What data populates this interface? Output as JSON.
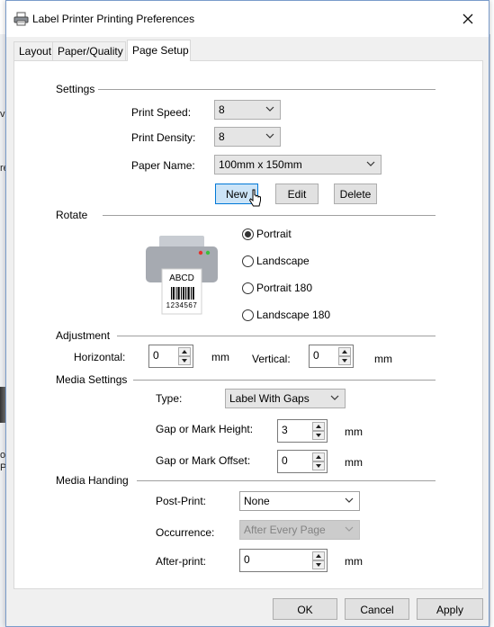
{
  "window": {
    "title": "Label Printer Printing Preferences"
  },
  "background": {
    "frag_top": "vi",
    "frag_mid": "re",
    "frag_bot1": "o",
    "frag_bot2": "P"
  },
  "tabs": [
    {
      "label": "Layout"
    },
    {
      "label": "Paper/Quality"
    },
    {
      "label": "Page Setup"
    }
  ],
  "settings": {
    "section": "Settings",
    "print_speed_label": "Print Speed:",
    "print_speed_value": "8",
    "print_density_label": "Print Density:",
    "print_density_value": "8",
    "paper_name_label": "Paper Name:",
    "paper_name_value": "100mm x 150mm",
    "new_label": "New",
    "edit_label": "Edit",
    "delete_label": "Delete"
  },
  "rotate": {
    "section": "Rotate",
    "preview_text": "ABCD",
    "preview_number": "1234567",
    "options": [
      {
        "label": "Portrait",
        "checked": true
      },
      {
        "label": "Landscape",
        "checked": false
      },
      {
        "label": "Portrait 180",
        "checked": false
      },
      {
        "label": "Landscape 180",
        "checked": false
      }
    ]
  },
  "adjustment": {
    "section": "Adjustment",
    "horizontal_label": "Horizontal:",
    "horizontal_value": "0",
    "horizontal_unit": "mm",
    "vertical_label": "Vertical:",
    "vertical_value": "0",
    "vertical_unit": "mm"
  },
  "media_settings": {
    "section": "Media Settings",
    "type_label": "Type:",
    "type_value": "Label With Gaps",
    "gap_height_label": "Gap or Mark Height:",
    "gap_height_value": "3",
    "gap_height_unit": "mm",
    "gap_offset_label": "Gap or Mark Offset:",
    "gap_offset_value": "0",
    "gap_offset_unit": "mm"
  },
  "media_handing": {
    "section": "Media Handing",
    "post_print_label": "Post-Print:",
    "post_print_value": "None",
    "occurrence_label": "Occurrence:",
    "occurrence_value": "After Every Page",
    "after_print_label": "After-print:",
    "after_print_value": "0",
    "after_print_unit": "mm"
  },
  "footer": {
    "ok_label": "OK",
    "cancel_label": "Cancel",
    "apply_label": "Apply"
  },
  "colors": {
    "accent": "#0078d7",
    "focus_fill": "#cce4f7",
    "printer_body": "#a6aab1",
    "led_red": "#e5302a",
    "led_green": "#3bbf3b"
  }
}
